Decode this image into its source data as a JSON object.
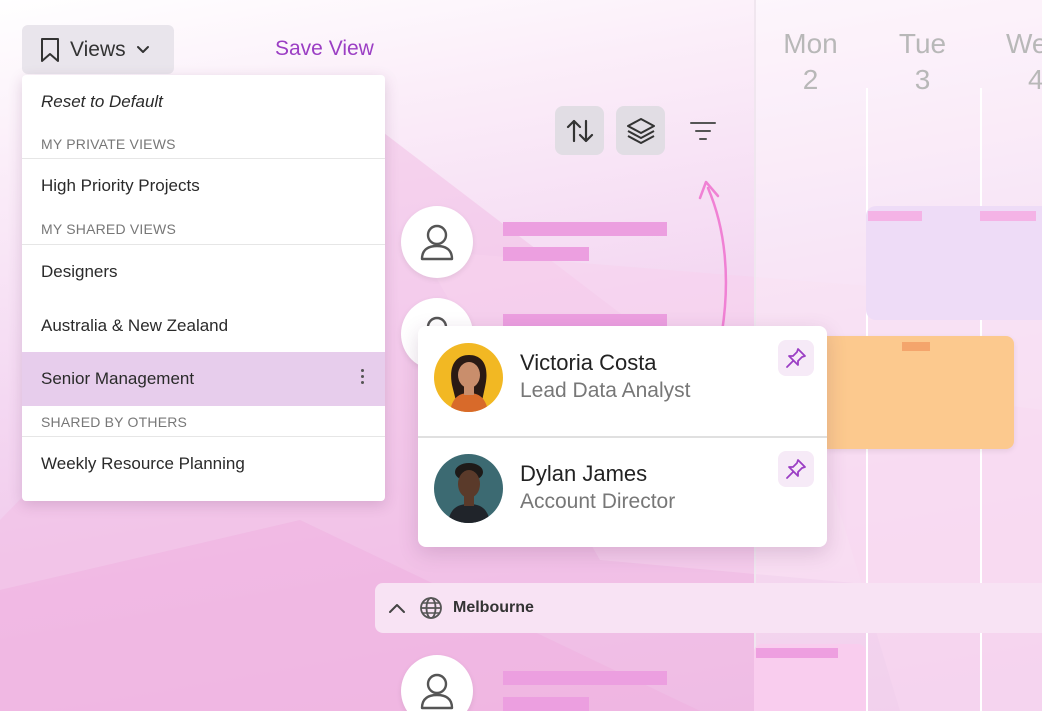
{
  "toolbar": {
    "views_label": "Views",
    "save_view_label": "Save View"
  },
  "views_menu": {
    "reset_label": "Reset to Default",
    "sections": [
      {
        "title": "MY PRIVATE VIEWS",
        "items": [
          "High Priority Projects"
        ]
      },
      {
        "title": "MY SHARED VIEWS",
        "items": [
          "Designers",
          "Australia & New Zealand",
          "Senior Management"
        ]
      },
      {
        "title": "SHARED BY OTHERS",
        "items": [
          "Weekly Resource Planning"
        ]
      }
    ],
    "selected_item": "Senior Management"
  },
  "calendar": {
    "days": [
      {
        "name": "Mon",
        "num": "2"
      },
      {
        "name": "Tue",
        "num": "3"
      },
      {
        "name": "We",
        "num": "4"
      }
    ]
  },
  "people_popup": [
    {
      "name": "Victoria Costa",
      "role": "Lead Data Analyst",
      "avatar_bg": "#f2b823"
    },
    {
      "name": "Dylan James",
      "role": "Account Director",
      "avatar_bg": "#3c6a72"
    }
  ],
  "group": {
    "label": "Melbourne"
  },
  "icons": {
    "views": "bookmark-icon",
    "sort": "sort-arrows-icon",
    "layers": "layers-icon",
    "filter": "filter-icon",
    "pin": "pin-icon",
    "collapse": "chevron-up-icon",
    "location": "globe-icon",
    "user": "user-icon"
  },
  "colors": {
    "accent": "#9b3ec4",
    "selected_row": "#e7cdec",
    "event_orange": "#fcc98e",
    "bar_pink": "#ec9fe0"
  }
}
